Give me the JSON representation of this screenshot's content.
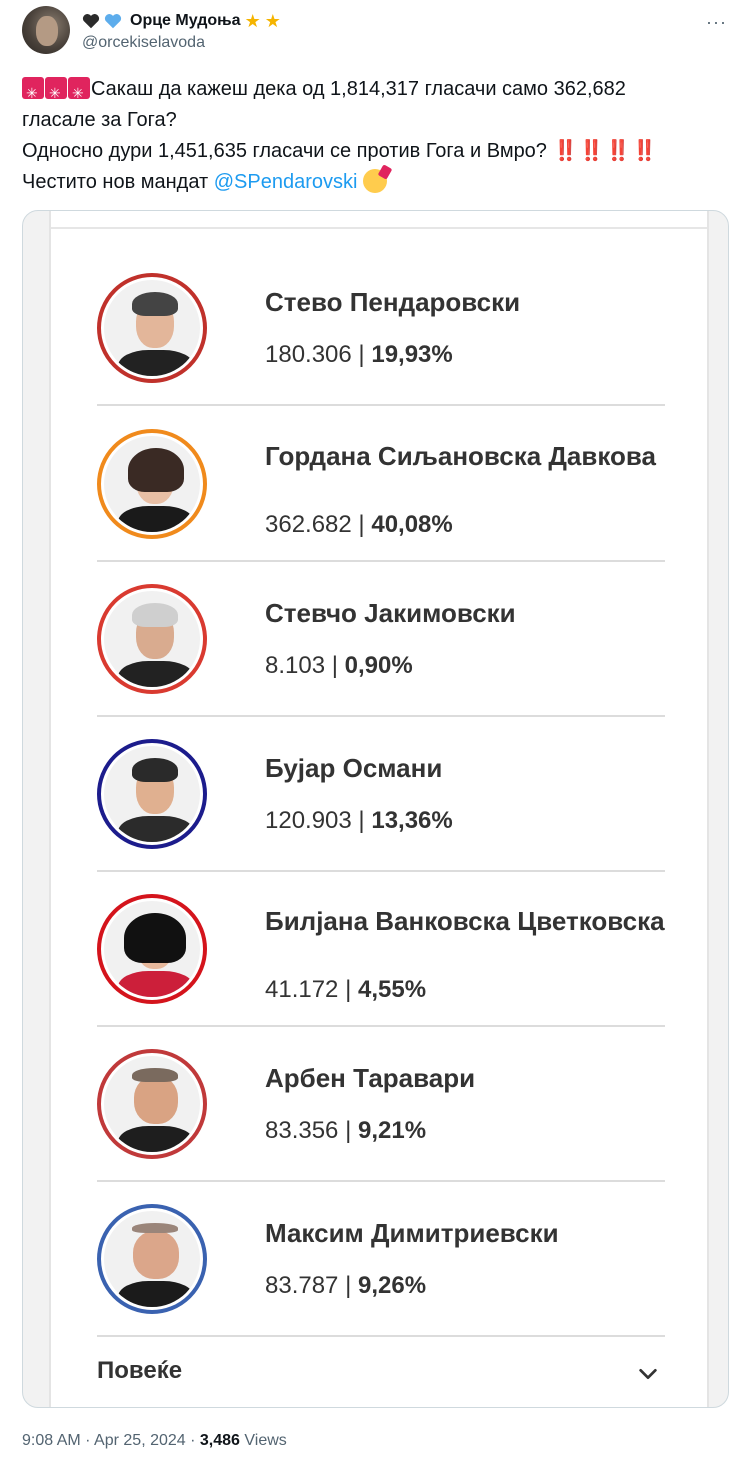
{
  "author": {
    "display_name": "Орце Мудоња",
    "handle": "@orcekiselavoda"
  },
  "menu_icon": "more-horizontal-icon",
  "tweet": {
    "line1": "Сакаш да кажеш дека од 1,814,317 гласачи само 362,682",
    "line2": "гласале за Гога?",
    "line3": "Односно дури 1,451,635 гласачи се против Гога и Вмро?",
    "line4_prefix": "Честито нов мандат",
    "mention": "@SPendarovski",
    "bang": "‼️ ‼️ ‼️ ‼️"
  },
  "results": {
    "candidates": [
      {
        "name": "Стево Пендаровски",
        "votes": "180.306",
        "percent": "19,93%",
        "ring_color": "#c0312b"
      },
      {
        "name": "Гордана Сиљановска Давкова",
        "votes": "362.682",
        "percent": "40,08%",
        "ring_color": "#f08a1c"
      },
      {
        "name": "Стевчо Јакимовски",
        "votes": "8.103",
        "percent": "0,90%",
        "ring_color": "#d93a30"
      },
      {
        "name": "Бујар Османи",
        "votes": "120.903",
        "percent": "13,36%",
        "ring_color": "#1c1c8c"
      },
      {
        "name": "Билјана Ванковска Цветковска",
        "votes": "41.172",
        "percent": "4,55%",
        "ring_color": "#d4141c"
      },
      {
        "name": "Арбен Таравари",
        "votes": "83.356",
        "percent": "9,21%",
        "ring_color": "#c0393a"
      },
      {
        "name": "Максим Димитриевски",
        "votes": "83.787",
        "percent": "9,26%",
        "ring_color": "#3a62b0"
      }
    ],
    "more_label": "Повеќе"
  },
  "meta": {
    "time": "9:08 AM",
    "dot": "·",
    "date": "Apr 25, 2024",
    "views_count": "3,486",
    "views_label": "Views"
  }
}
